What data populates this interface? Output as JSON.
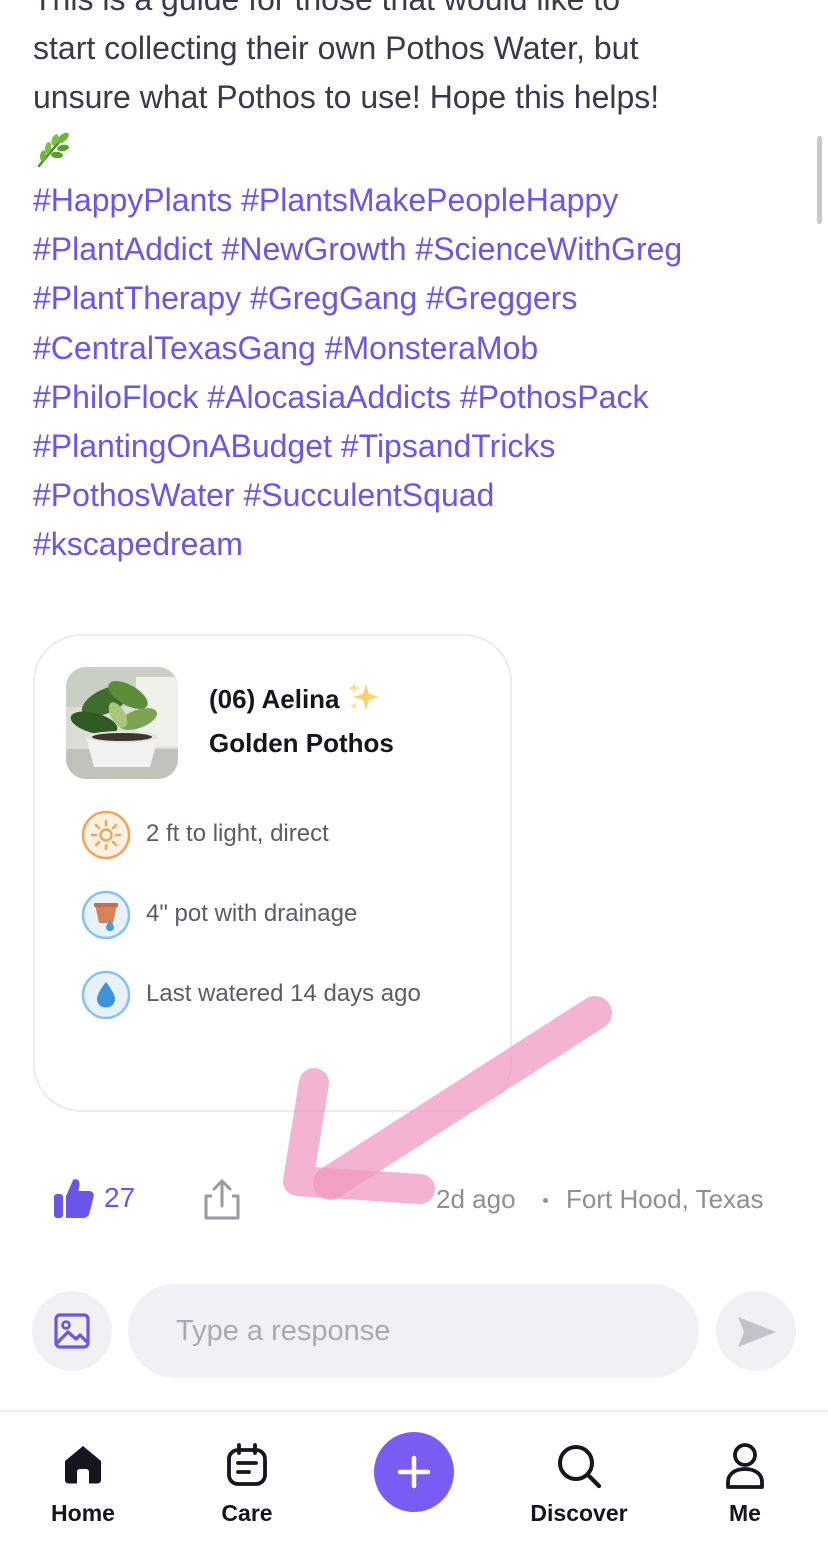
{
  "post": {
    "lines": [
      "This is a guide for those that would like to",
      "start collecting their own Pothos Water, but",
      "unsure what Pothos to use! Hope this helps!"
    ],
    "emoji": "🌿",
    "hashtag_lines": [
      [
        "#HappyPlants",
        "#PlantsMakePeopleHappy"
      ],
      [
        "#PlantAddict",
        "#NewGrowth",
        "#ScienceWithGreg"
      ],
      [
        "#PlantTherapy",
        "#GregGang",
        "#Greggers"
      ],
      [
        "#CentralTexasGang",
        "#MonsteraMob"
      ],
      [
        "#PhiloFlock",
        "#AlocasiaAddicts",
        "#PothosPack"
      ],
      [
        "#PlantingOnABudget",
        "#TipsandTricks"
      ],
      [
        "#PothosWater",
        "#SucculentSquad"
      ],
      [
        "#kscapedream"
      ]
    ],
    "accent_color": "#6b55ea"
  },
  "plant_card": {
    "name": "(06) Aelina",
    "name_emoji": "sparkles-icon",
    "type": "Golden Pothos",
    "care": [
      {
        "icon": "sun-icon",
        "text": "2 ft to light, direct"
      },
      {
        "icon": "pot-icon",
        "text": "4\" pot with drainage"
      },
      {
        "icon": "water-drop-icon",
        "text": "Last watered 14 days ago"
      }
    ]
  },
  "actions": {
    "like_count": "27",
    "time": "2d ago",
    "location": "Fort Hood, Texas"
  },
  "composer": {
    "placeholder": "Type a response"
  },
  "nav": {
    "items": [
      {
        "label": "Home",
        "icon": "home-icon",
        "active": true
      },
      {
        "label": "Care",
        "icon": "care-calendar-icon",
        "active": false
      },
      {
        "label": "",
        "icon": "plus-icon",
        "active": false
      },
      {
        "label": "Discover",
        "icon": "search-icon",
        "active": false
      },
      {
        "label": "Me",
        "icon": "person-icon",
        "active": false
      }
    ],
    "add_color": "#7a5cf5"
  }
}
